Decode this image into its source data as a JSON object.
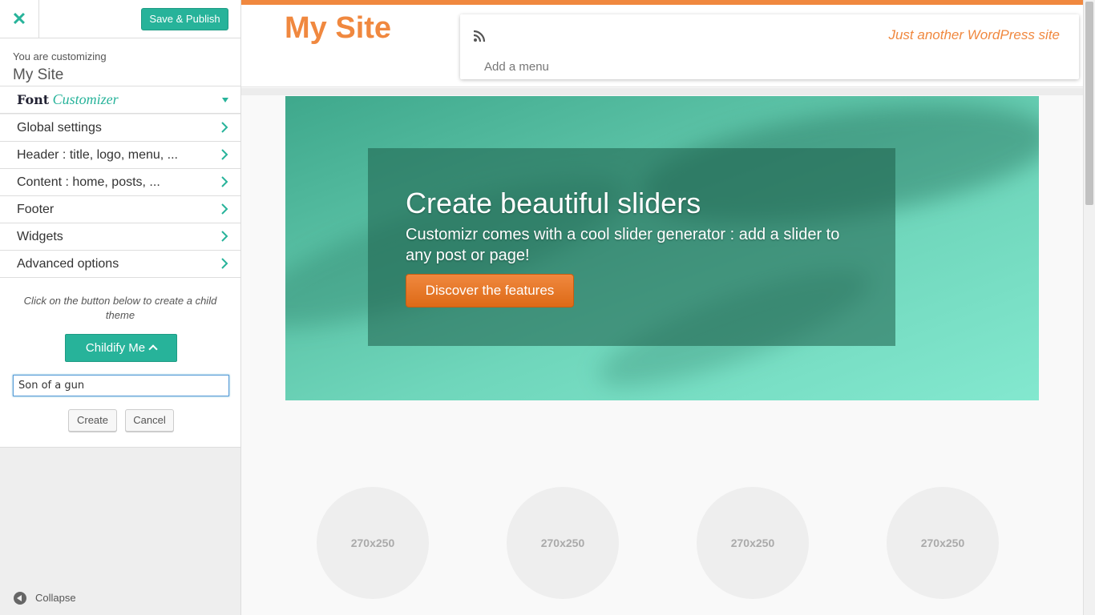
{
  "sidebar": {
    "close_icon": "✕",
    "save_label": "Save & Publish",
    "customizing_label": "You are customizing",
    "site_name": "My Site",
    "font_customizer": {
      "part1": "Font",
      "part2": "Customizer"
    },
    "sections": [
      {
        "label": "Global settings"
      },
      {
        "label": "Header : title, logo, menu, ..."
      },
      {
        "label": "Content : home, posts, ..."
      },
      {
        "label": "Footer"
      },
      {
        "label": "Widgets"
      },
      {
        "label": "Advanced options"
      }
    ],
    "childify": {
      "text": "Click on the button below to create a child theme",
      "button_label": "Childify Me",
      "input_value": "Son of a gun",
      "create_label": "Create",
      "cancel_label": "Cancel"
    },
    "collapse_label": "Collapse"
  },
  "site": {
    "title": "My Site",
    "tagline": "Just another WordPress site",
    "add_menu": "Add a menu",
    "slider": {
      "title": "Create beautiful sliders",
      "text": "Customizr comes with a cool slider generator : add a slider to any post or page!",
      "button_label": "Discover the features"
    },
    "thumbnails": [
      "270x250",
      "270x250",
      "270x250",
      "270x250"
    ]
  },
  "colors": {
    "accent": "#27b39a",
    "brand": "#f0883f"
  }
}
